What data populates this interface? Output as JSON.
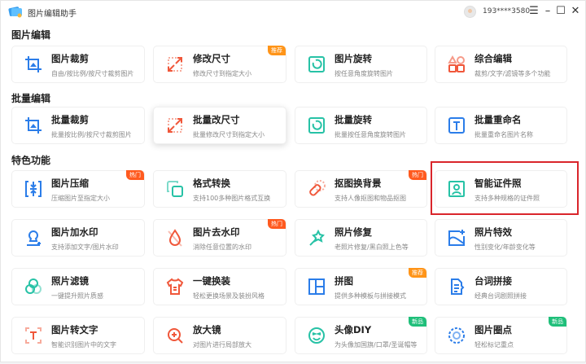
{
  "app": {
    "title": "图片编辑助手",
    "phone": "193****3580"
  },
  "window_buttons": [
    "menu",
    "minimize",
    "maximize",
    "close"
  ],
  "colors": {
    "hot": "#ff5a1f",
    "recommend": "#ff9418",
    "new": "#1fbf7a",
    "highlight": "#d9252b"
  },
  "sections": [
    {
      "title": "图片编辑",
      "cards": [
        {
          "title": "图片裁剪",
          "sub": "自由/按比例/按尺寸裁剪图片",
          "icon": "crop-icon",
          "color": "#2b7de9"
        },
        {
          "title": "修改尺寸",
          "sub": "修改尺寸到指定大小",
          "icon": "resize-icon",
          "color": "#f0573a",
          "badge": "推荐",
          "badge_type": "recommend"
        },
        {
          "title": "图片旋转",
          "sub": "按任意角度旋转图片",
          "icon": "rotate-icon",
          "color": "#27c2a6"
        },
        {
          "title": "综合编辑",
          "sub": "裁剪/文字/滤镜等多个功能",
          "icon": "shapes-icon",
          "color": "#f0573a"
        }
      ]
    },
    {
      "title": "批量编辑",
      "cards": [
        {
          "title": "批量裁剪",
          "sub": "批量按比例/按尺寸裁剪图片",
          "icon": "crop-icon",
          "color": "#2b7de9"
        },
        {
          "title": "批量改尺寸",
          "sub": "批量修改尺寸到指定大小",
          "icon": "resize-icon",
          "color": "#f0573a"
        },
        {
          "title": "批量旋转",
          "sub": "批量按任意角度旋转图片",
          "icon": "rotate-icon",
          "color": "#27c2a6"
        },
        {
          "title": "批量重命名",
          "sub": "批量重命名图片名称",
          "icon": "rename-icon",
          "color": "#2b7de9"
        }
      ]
    },
    {
      "title": "特色功能",
      "cards": [
        {
          "title": "图片压缩",
          "sub": "压缩图片至指定大小",
          "icon": "compress-icon",
          "color": "#2b7de9",
          "badge": "热门",
          "badge_type": "hot"
        },
        {
          "title": "格式转换",
          "sub": "支持100多种图片格式互换",
          "icon": "convert-icon",
          "color": "#27c2a6"
        },
        {
          "title": "抠图换背景",
          "sub": "支持人像抠图和物品抠图",
          "icon": "cutout-icon",
          "color": "#f0573a",
          "badge": "热门",
          "badge_type": "hot"
        },
        {
          "title": "智能证件照",
          "sub": "支持多种规格的证件照",
          "icon": "id-photo-icon",
          "color": "#27c2a6"
        },
        {
          "title": "图片加水印",
          "sub": "支持添加文字/图片水印",
          "icon": "stamp-icon",
          "color": "#2b7de9"
        },
        {
          "title": "图片去水印",
          "sub": "消除任意位置的水印",
          "icon": "drop-icon",
          "color": "#f0573a",
          "badge": "热门",
          "badge_type": "hot"
        },
        {
          "title": "照片修复",
          "sub": "老照片修复/黑白照上色等",
          "icon": "magic-wand-icon",
          "color": "#27c2a6"
        },
        {
          "title": "照片特效",
          "sub": "性别变化/年龄变化等",
          "icon": "effect-icon",
          "color": "#2b7de9"
        },
        {
          "title": "照片滤镜",
          "sub": "一键提升照片质感",
          "icon": "filter-icon",
          "color": "#27c2a6"
        },
        {
          "title": "一键换装",
          "sub": "轻松更换场景及装扮风格",
          "icon": "shirt-icon",
          "color": "#f0573a"
        },
        {
          "title": "拼图",
          "sub": "提供多种模板与拼接模式",
          "icon": "collage-icon",
          "color": "#2b7de9",
          "badge": "推荐",
          "badge_type": "recommend"
        },
        {
          "title": "台词拼接",
          "sub": "经典台词剧照拼接",
          "icon": "script-icon",
          "color": "#2b7de9"
        },
        {
          "title": "图片转文字",
          "sub": "智能识别图片中的文字",
          "icon": "ocr-icon",
          "color": "#f0573a"
        },
        {
          "title": "放大镜",
          "sub": "对图片进行局部放大",
          "icon": "magnifier-icon",
          "color": "#f0573a"
        },
        {
          "title": "头像DIY",
          "sub": "为头像加国旗/口罩/圣诞帽等",
          "icon": "smiley-icon",
          "color": "#27c2a6",
          "badge": "新品",
          "badge_type": "new"
        },
        {
          "title": "图片圈点",
          "sub": "轻松标记重点",
          "icon": "circle-mark-icon",
          "color": "#2b7de9",
          "badge": "新品",
          "badge_type": "new"
        }
      ]
    }
  ]
}
